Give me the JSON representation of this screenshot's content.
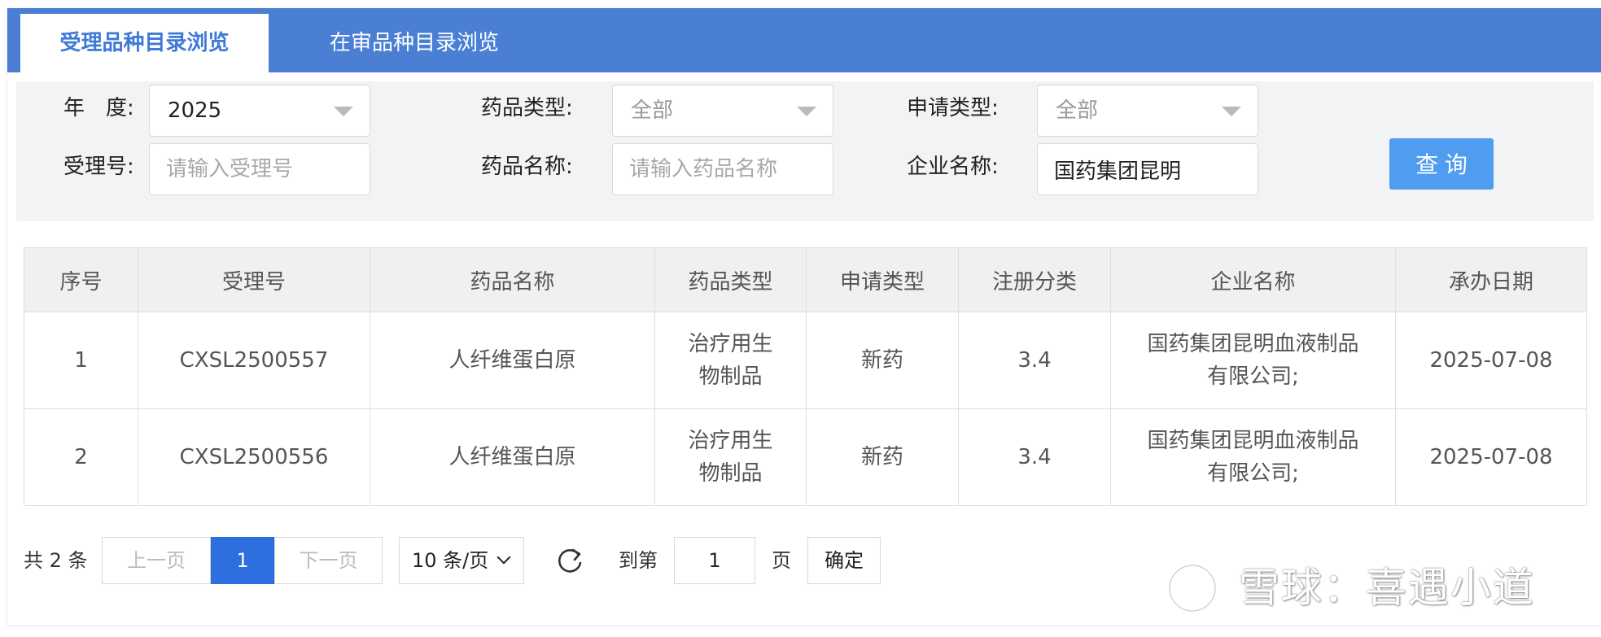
{
  "tabs": [
    {
      "label": "受理品种目录浏览",
      "active": true
    },
    {
      "label": "在审品种目录浏览",
      "active": false
    }
  ],
  "filters": {
    "year": {
      "label": "年　度:",
      "value": "2025"
    },
    "drug_type": {
      "label": "药品类型:",
      "value": "全部"
    },
    "apply_type": {
      "label": "申请类型:",
      "value": "全部"
    },
    "accept_no": {
      "label": "受理号:",
      "placeholder": "请输入受理号",
      "value": ""
    },
    "drug_name": {
      "label": "药品名称:",
      "placeholder": "请输入药品名称",
      "value": ""
    },
    "company": {
      "label": "企业名称:",
      "value": "国药集团昆明"
    },
    "query_label": "查 询"
  },
  "table": {
    "headers": [
      "序号",
      "受理号",
      "药品名称",
      "药品类型",
      "申请类型",
      "注册分类",
      "企业名称",
      "承办日期"
    ],
    "rows": [
      {
        "no": "1",
        "accept_no": "CXSL2500557",
        "drug_name": "人纤维蛋白原",
        "drug_type_l1": "治疗用生",
        "drug_type_l2": "物制品",
        "apply_type": "新药",
        "reg_class": "3.4",
        "company_l1": "国药集团昆明血液制品",
        "company_l2": "有限公司;",
        "date": "2025-07-08"
      },
      {
        "no": "2",
        "accept_no": "CXSL2500556",
        "drug_name": "人纤维蛋白原",
        "drug_type_l1": "治疗用生",
        "drug_type_l2": "物制品",
        "apply_type": "新药",
        "reg_class": "3.4",
        "company_l1": "国药集团昆明血液制品",
        "company_l2": "有限公司;",
        "date": "2025-07-08"
      }
    ]
  },
  "pagination": {
    "total_text": "共 2 条",
    "prev_label": "上一页",
    "current_page": "1",
    "next_label": "下一页",
    "page_size": "10 条/页",
    "goto_prefix": "到第",
    "goto_value": "1",
    "goto_suffix": "页",
    "confirm_label": "确定"
  },
  "watermark": {
    "text": "雪球：喜遇小道",
    "icon": "xueqiu-logo-icon"
  },
  "colors": {
    "tabbar": "#4a7fd4",
    "active_tab_text": "#3f7ad6",
    "query_button": "#4f9cf0",
    "current_page": "#2e6fe0"
  }
}
